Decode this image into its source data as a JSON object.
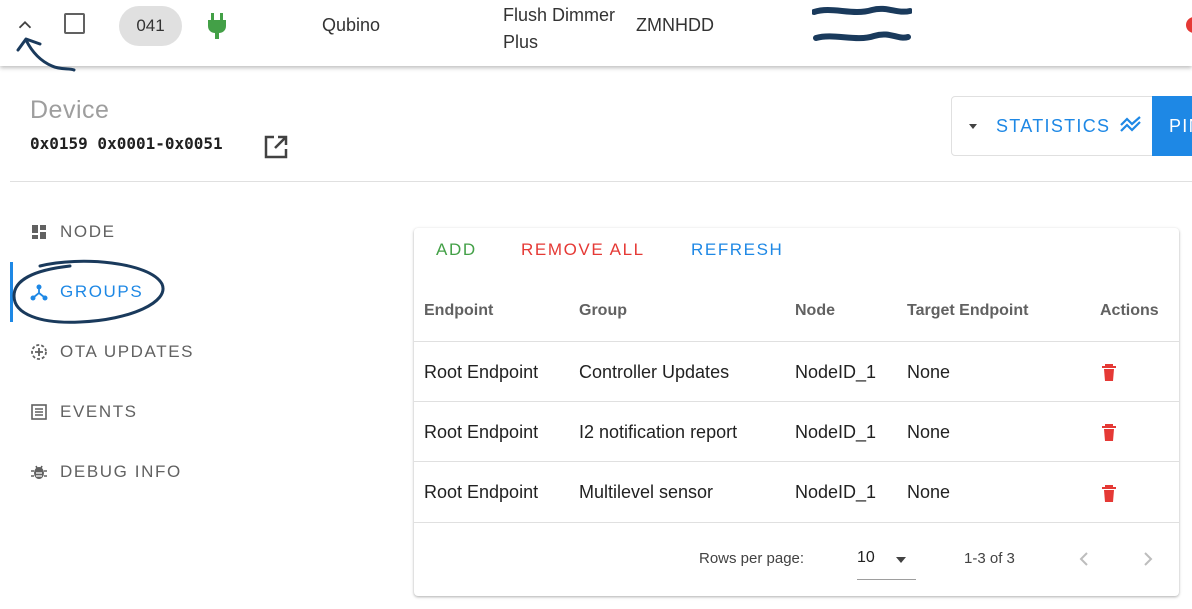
{
  "device_row": {
    "node_id": "041",
    "manufacturer": "Qubino",
    "product_name": "Flush Dimmer Plus",
    "product_code": "ZMNHDD",
    "status_color": "#e53935",
    "power_icon": "plug-icon",
    "power_color": "#43a047"
  },
  "device_header": {
    "title": "Device",
    "device_id": "0x0159 0x0001-0x0051",
    "statistics_label": "STATISTICS",
    "ping_label": "PIN"
  },
  "sidebar": {
    "items": [
      {
        "label": "NODE",
        "icon": "dashboard-icon"
      },
      {
        "label": "GROUPS",
        "icon": "hub-icon"
      },
      {
        "label": "OTA UPDATES",
        "icon": "ota-icon"
      },
      {
        "label": "EVENTS",
        "icon": "list-icon"
      },
      {
        "label": "DEBUG INFO",
        "icon": "bug-icon"
      }
    ],
    "active": "GROUPS"
  },
  "groups": {
    "buttons": {
      "add": "ADD",
      "remove_all": "REMOVE ALL",
      "refresh": "REFRESH"
    },
    "columns": [
      "Endpoint",
      "Group",
      "Node",
      "Target Endpoint",
      "Actions"
    ],
    "rows": [
      {
        "endpoint": "Root Endpoint",
        "group": "Controller Updates",
        "node": "NodeID_1",
        "target": "None"
      },
      {
        "endpoint": "Root Endpoint",
        "group": "I2 notification report",
        "node": "NodeID_1",
        "target": "None"
      },
      {
        "endpoint": "Root Endpoint",
        "group": "Multilevel sensor",
        "node": "NodeID_1",
        "target": "None"
      }
    ],
    "pagination": {
      "rows_per_page_label": "Rows per page:",
      "rows_per_page": "10",
      "range": "1-3 of 3"
    }
  },
  "colors": {
    "accent": "#1e88e5",
    "add": "#43a047",
    "danger": "#e53935",
    "annotation": "#1a3a5c"
  }
}
